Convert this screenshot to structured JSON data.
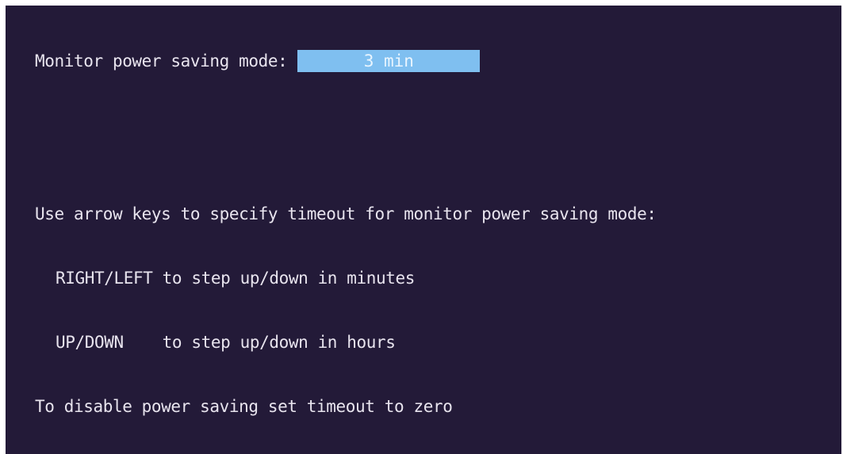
{
  "setting": {
    "label": "Monitor power saving mode:",
    "value": "3 min"
  },
  "help": {
    "lines": [
      "Use arrow keys to specify timeout for monitor power saving mode:",
      "RIGHT/LEFT to step up/down in minutes",
      "UP/DOWN    to step up/down in hours",
      "To disable power saving set timeout to zero"
    ]
  },
  "colors": {
    "background": "#231a38",
    "text": "#e8e4ee",
    "selected_field": "#7fbff0"
  }
}
